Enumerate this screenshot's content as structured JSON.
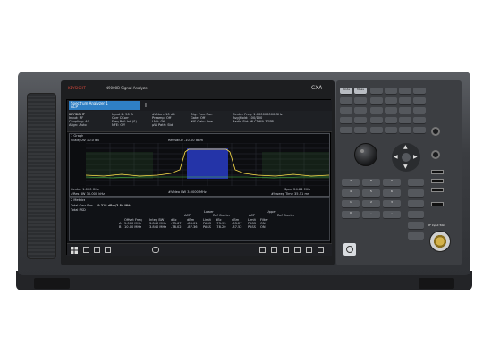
{
  "instrument": {
    "brand": "KEYSIGHT",
    "model_title": "N9000B Signal Analyzer",
    "badge": "CXA",
    "rf_input_label": "RF Input 50Ω"
  },
  "screen": {
    "tab_label": "Spectrum Analyzer 1",
    "tab_sub": "ACP",
    "add_tab": "+",
    "status_left": [
      "KEYSIGHT",
      "Input: RF",
      "Coupling: AC",
      "Align: Auto"
    ],
    "status_mid": [
      "Input Z: 50 Ω",
      "Corr CCorr",
      "Freq Ref: Int (S)",
      "NFE: Off"
    ],
    "status_mid2": [
      "#Atten: 10 dB",
      "Preamp: Off",
      "LNA: Off",
      "µW Path: Std"
    ],
    "status_right": [
      "Trig: Free Run",
      "Gate: Off",
      "#IF Gain: Low"
    ],
    "status_far": [
      "Center Freq: 1.000000000 GHz",
      "Avg|Hold: 100/100",
      "Radio Std: W-CDMA 3GPP"
    ],
    "pane_label": "1 Graph",
    "ref_label": "Scale/Div 10.0 dB",
    "ref_level": "Ref Value -10.00 dBm",
    "center_label": "Center 1.000 GHz",
    "res_bw": "#Res BW 30.000 kHz",
    "video_bw": "#Video BW 3.0000 MHz",
    "span": "Span 24.84 MHz",
    "sweep": "#Sweep Time 35.51 ms",
    "y_ticks": [
      "-20.0",
      "-30.0",
      "-40.0",
      "-50.0",
      "-60.0",
      "-70.0",
      "-80.0",
      "-90.0"
    ],
    "metrics_label": "2 Metrics",
    "total_carrier": "Total Carr Pwr",
    "total_carrier_val": "-9.318 dBm/3.84 MHz",
    "total_psd": "Total PSD",
    "table_header_groups": [
      "Lower",
      "Upper"
    ],
    "table_header_sub": [
      "ACP",
      "Ref Carrier",
      "ACP",
      "Ref Carrier"
    ],
    "table_cols": [
      "Offset Freq",
      "Integ BW",
      "dBc",
      "dBm",
      "Limit",
      "dBc",
      "dBm",
      "Limit",
      "Filter"
    ],
    "table_rows": [
      [
        "A",
        "5.000 MHz",
        "3.840 MHz",
        "-73.67",
        "-83.01",
        "PASS",
        "-73.93",
        "-83.27",
        "PASS",
        "ON"
      ],
      [
        "B",
        "10.00 MHz",
        "3.840 MHz",
        "-78.02",
        "-87.36",
        "PASS",
        "-78.20",
        "-87.52",
        "PASS",
        "ON"
      ]
    ]
  },
  "keys": {
    "top_labels": [
      "Mode",
      "Meas",
      "Mode Setup",
      "Meas Setup",
      "Trace",
      "Display",
      "Marker",
      "Peak",
      "Save",
      "Recall",
      "Preset"
    ],
    "numpad": [
      "7",
      "8",
      "9",
      "4",
      "5",
      "6",
      "1",
      "2",
      "3",
      "0",
      ".",
      "-"
    ]
  }
}
